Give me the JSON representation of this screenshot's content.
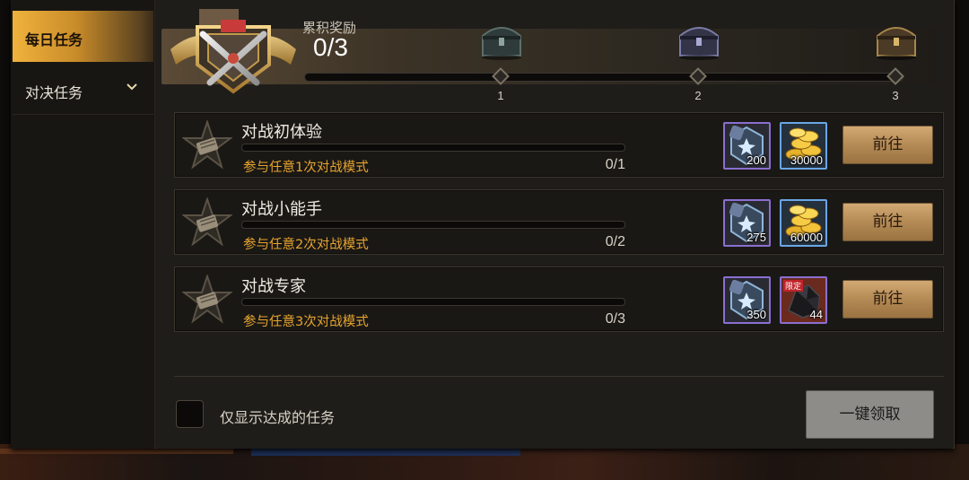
{
  "sidebar": {
    "tabs": [
      {
        "label": "每日任务",
        "active": true
      },
      {
        "label": "对决任务",
        "active": false
      }
    ]
  },
  "rewards_header": {
    "title": "累积奖励",
    "count": "0/3",
    "progress": 0,
    "milestones": [
      "1",
      "2",
      "3"
    ]
  },
  "tasks": [
    {
      "title": "对战初体验",
      "desc": "参与任意1次对战模式",
      "progress": "0/1",
      "progress_fraction": 0,
      "rewards": [
        {
          "qty": "200",
          "icon": "crystal-shard-icon",
          "rarity": "purple"
        },
        {
          "qty": "30000",
          "icon": "gold-coins-icon",
          "rarity": "blue"
        }
      ],
      "button": "前往"
    },
    {
      "title": "对战小能手",
      "desc": "参与任意2次对战模式",
      "progress": "0/2",
      "progress_fraction": 0,
      "rewards": [
        {
          "qty": "275",
          "icon": "crystal-shard-icon",
          "rarity": "purple"
        },
        {
          "qty": "60000",
          "icon": "gold-coins-icon",
          "rarity": "blue"
        }
      ],
      "button": "前往"
    },
    {
      "title": "对战专家",
      "desc": "参与任意3次对战模式",
      "progress": "0/3",
      "progress_fraction": 0,
      "rewards": [
        {
          "qty": "350",
          "icon": "crystal-shard-icon",
          "rarity": "purple"
        },
        {
          "qty": "44",
          "icon": "dark-ore-icon",
          "rarity": "purple",
          "tag": "限定"
        }
      ],
      "button": "前往"
    }
  ],
  "footer": {
    "checkbox_label": "仅显示达成的任务",
    "claim_all": "一键领取"
  },
  "colors": {
    "accent_gold": "#d9a235",
    "desc_orange": "#e7a42e",
    "purple_frame": "#8a6fd0",
    "blue_frame": "#6aa6e6"
  }
}
